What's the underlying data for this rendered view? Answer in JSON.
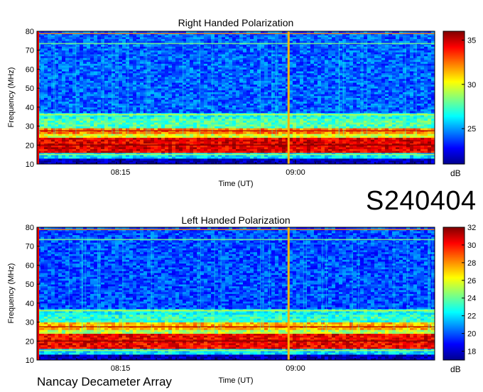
{
  "session_code": "S240404",
  "instrument": "Nancay Decameter Array",
  "chart_data": [
    {
      "type": "heatmap",
      "title": "Right Handed Polarization",
      "xlabel": "Time (UT)",
      "ylabel": "Frequency (MHz)",
      "x_ticks": [
        "08:15",
        "09:00"
      ],
      "y_ticks": [
        10,
        20,
        30,
        40,
        50,
        60,
        70,
        80
      ],
      "ylim": [
        10,
        80
      ],
      "colorbar": {
        "label": "dB",
        "ticks": [
          25,
          30,
          35
        ],
        "range": [
          21,
          36
        ]
      },
      "bands": [
        {
          "freq": [
            10,
            13
          ],
          "level": 0.05
        },
        {
          "freq": [
            13,
            16
          ],
          "level": 0.35
        },
        {
          "freq": [
            16,
            24
          ],
          "level": 0.9
        },
        {
          "freq": [
            24,
            26
          ],
          "level": 0.6
        },
        {
          "freq": [
            26,
            29
          ],
          "level": 0.75
        },
        {
          "freq": [
            29,
            34
          ],
          "level": 0.45
        },
        {
          "freq": [
            34,
            37
          ],
          "level": 0.4
        },
        {
          "freq": [
            37,
            80
          ],
          "level": 0.22
        }
      ],
      "burst_time_fraction": 0.63
    },
    {
      "type": "heatmap",
      "title": "Left Handed Polarization",
      "xlabel": "Time (UT)",
      "ylabel": "Frequency (MHz)",
      "x_ticks": [
        "08:15",
        "09:00"
      ],
      "y_ticks": [
        10,
        20,
        30,
        40,
        50,
        60,
        70,
        80
      ],
      "ylim": [
        10,
        80
      ],
      "colorbar": {
        "label": "dB",
        "ticks": [
          18,
          20,
          22,
          24,
          26,
          28,
          30,
          32
        ],
        "range": [
          17,
          32
        ]
      },
      "bands": [
        {
          "freq": [
            10,
            13
          ],
          "level": 0.05
        },
        {
          "freq": [
            13,
            16
          ],
          "level": 0.35
        },
        {
          "freq": [
            16,
            24
          ],
          "level": 0.88
        },
        {
          "freq": [
            24,
            26
          ],
          "level": 0.55
        },
        {
          "freq": [
            26,
            30
          ],
          "level": 0.7
        },
        {
          "freq": [
            30,
            34
          ],
          "level": 0.42
        },
        {
          "freq": [
            34,
            37
          ],
          "level": 0.38
        },
        {
          "freq": [
            37,
            80
          ],
          "level": 0.2
        }
      ],
      "burst_time_fraction": 0.63
    }
  ]
}
